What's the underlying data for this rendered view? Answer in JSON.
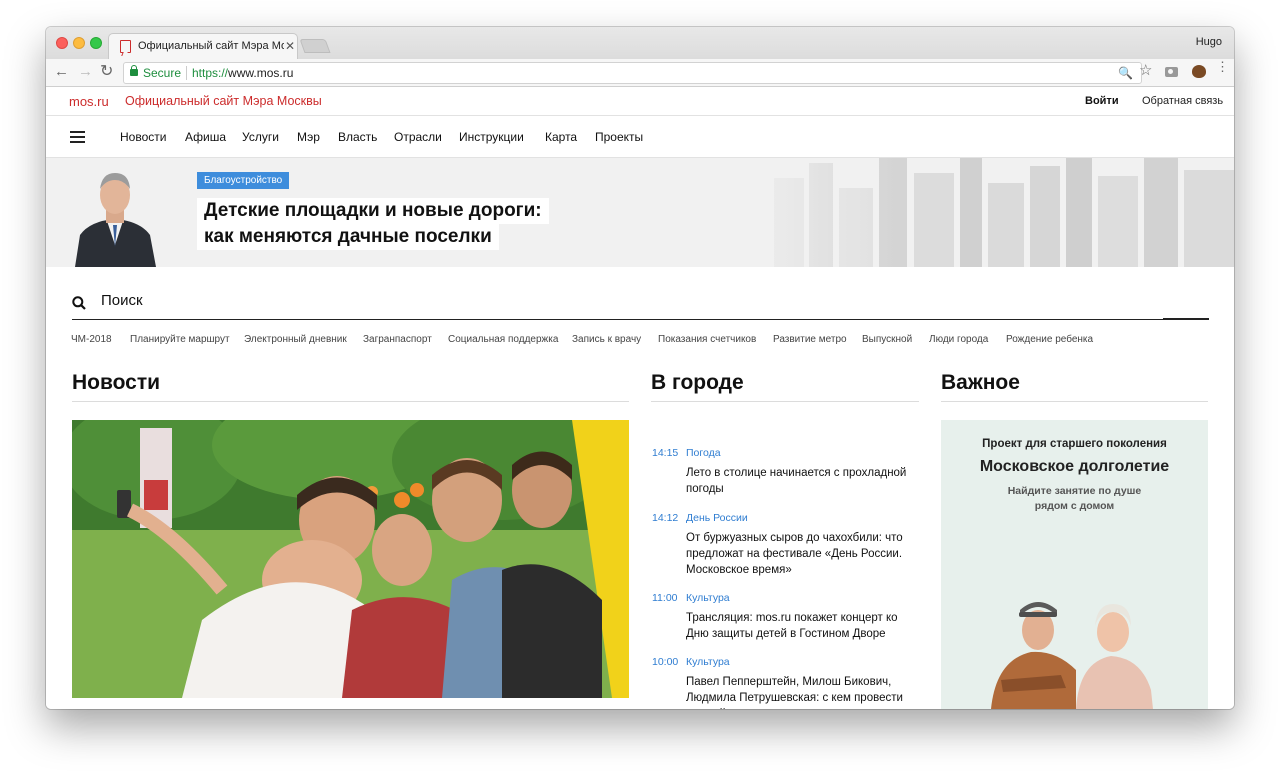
{
  "browser": {
    "tab_title": "Официальный сайт Мэра Мо",
    "tab_close": "✕",
    "profile_name": "Hugo",
    "back": "←",
    "forward": "→",
    "reload": "↻",
    "secure_label": "Secure",
    "url_scheme": "https://",
    "url_host": "www.mos.ru",
    "zoom": "🔍",
    "star": "☆",
    "menu": "⋮"
  },
  "site": {
    "logo": "mos.ru",
    "title": "Официальный сайт Мэра Москвы",
    "login": "Войти",
    "feedback": "Обратная связь"
  },
  "nav": {
    "items": [
      "Новости",
      "Афиша",
      "Услуги",
      "Мэр",
      "Власть",
      "Отрасли",
      "Инструкции",
      "Карта",
      "Проекты"
    ]
  },
  "hero": {
    "tag": "Благоустройство",
    "title_line1": "Детские площадки и новые дороги:",
    "title_line2": "как меняются дачные поселки"
  },
  "search": {
    "label": "Поиск"
  },
  "quicklinks": [
    "ЧМ-2018",
    "Планируйте маршрут",
    "Электронный дневник",
    "Загранпаспорт",
    "Социальная поддержка",
    "Запись к врачу",
    "Показания счетчиков",
    "Развитие метро",
    "Выпускной",
    "Люди города",
    "Рождение ребенка"
  ],
  "sections": {
    "news": "Новости",
    "city": "В городе",
    "important": "Важное"
  },
  "city_feed": [
    {
      "time": "14:15",
      "category": "Погода",
      "text": "Лето в столице начинается с прохладной погоды"
    },
    {
      "time": "14:12",
      "category": "День России",
      "text": "От буржуазных сыров до чахохбили: что предложат на фестивале «День России. Московское время»"
    },
    {
      "time": "11:00",
      "category": "Культура",
      "text": "Трансляция: mos.ru покажет концерт ко Дню защиты детей в Гостином Дворе"
    },
    {
      "time": "10:00",
      "category": "Культура",
      "text": "Павел Пепперштейн, Милош Бикович, Людмила Петрушевская: с кем провести первый вечер лета"
    }
  ],
  "important": {
    "kicker": "Проект для старшего поколения",
    "title": "Московское долголетие",
    "sub_line1": "Найдите занятие по душе",
    "sub_line2": "рядом с домом"
  },
  "colors": {
    "brand_red": "#cc2c2c",
    "link_blue": "#2f7dd1",
    "tag_blue": "#3e8ddc",
    "secure_green": "#1e8e3e",
    "important_bg": "#e7f0ec"
  }
}
